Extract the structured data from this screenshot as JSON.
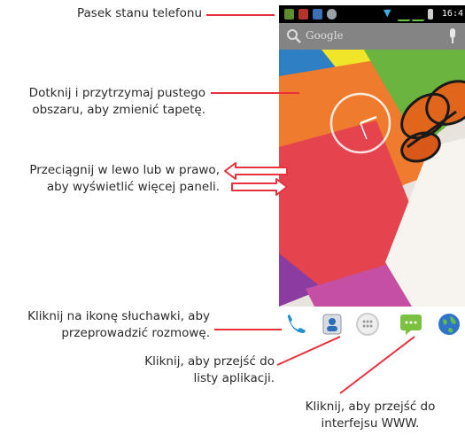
{
  "annotations": {
    "status_bar": "Pasek stanu telefonu",
    "wallpaper_line1": "Dotknij i przytrzymaj pustego",
    "wallpaper_line2": "obszaru, aby zmienić tapetę.",
    "swipe_line1": "Przeciągnij w lewo lub w prawo,",
    "swipe_line2": "aby wyświetlić więcej paneli.",
    "phone_line1": "Kliknij na ikonę słuchawki, aby",
    "phone_line2": "przeprowadzić rozmowę.",
    "apps_line1": "Kliknij, aby przejść do",
    "apps_line2": "listy aplikacji.",
    "web_line1": "Kliknij, aby przejść do",
    "web_line2": "interfejsu WWW."
  },
  "phone": {
    "status_time": "16:4",
    "search_label": "Google",
    "dock_icons": [
      "phone-icon",
      "contacts-icon",
      "app-drawer-icon",
      "messaging-icon",
      "browser-icon"
    ],
    "colors": {
      "accent_line": "#e8313c",
      "arrow": "#e8313c",
      "status_bar": "#000000"
    }
  }
}
